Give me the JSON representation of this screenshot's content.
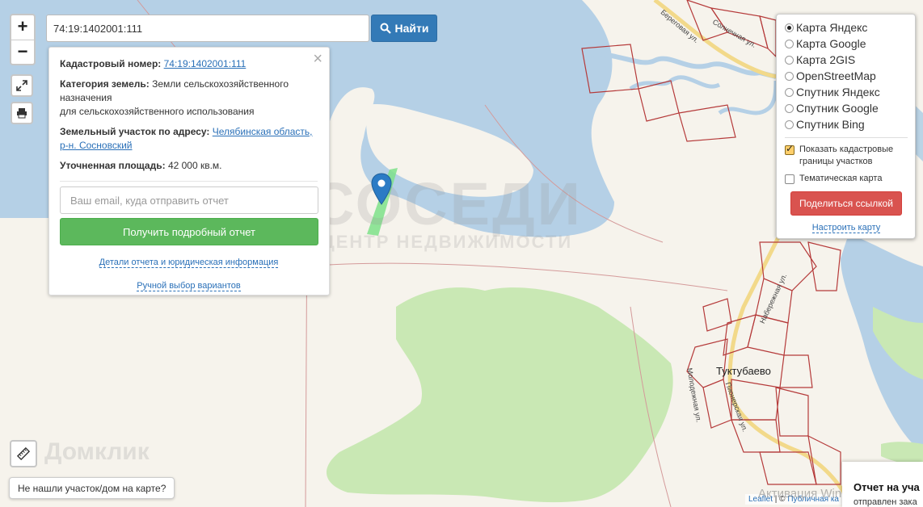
{
  "search": {
    "value": "74:19:1402001:111",
    "button_label": "Найти"
  },
  "zoom": {
    "in_label": "+",
    "out_label": "−"
  },
  "popup": {
    "close_label": "×",
    "cadastral_label": "Кадастровый номер:",
    "cadastral_value": "74:19:1402001:111",
    "category_label": "Категория земель:",
    "category_value_1": "Земли сельскохозяйственного",
    "category_value_2": "назначения",
    "category_value_3": "для сельскохозяйственного использования",
    "address_label": "Земельный участок по адресу:",
    "address_link_1": "Челябинская область,",
    "address_link_2": "р-н. Сосновский",
    "area_label": "Уточненная площадь:",
    "area_value": "42 000 кв.м.",
    "email_placeholder": "Ваш email, куда отправить отчет",
    "report_button": "Получить подробный отчет",
    "details_link": "Детали отчета и юридическая информация",
    "manual_link": "Ручной выбор вариантов"
  },
  "layers": {
    "options": [
      {
        "label": "Карта Яндекс",
        "selected": true
      },
      {
        "label": "Карта Google",
        "selected": false
      },
      {
        "label": "Карта 2GIS",
        "selected": false
      },
      {
        "label": "OpenStreetMap",
        "selected": false
      },
      {
        "label": "Спутник Яндекс",
        "selected": false
      },
      {
        "label": "Спутник Google",
        "selected": false
      },
      {
        "label": "Спутник Bing",
        "selected": false
      }
    ],
    "show_borders_1": "Показать кадастровые",
    "show_borders_2": "границы участков",
    "thematic": "Тематическая карта",
    "share_button": "Поделиться ссылкой",
    "setup_link": "Настроить карту"
  },
  "not_found": "Не нашли участок/дом на карте?",
  "attribution": {
    "leaflet": "Leaflet",
    "sep": " | © ",
    "public": "Публичная ка"
  },
  "report_panel": {
    "title": "Отчет на уча",
    "subtitle": "отправлен зака"
  },
  "activation": "Активация Windows",
  "watermark": {
    "main": "СОСЕДИ",
    "sub": "ЦЕНТР НЕДВИЖИМОСТИ"
  },
  "domclick": "Домклик",
  "map": {
    "town": "Туктубаево",
    "streets": [
      "Береговая ул.",
      "Солнечная ул.",
      "Набережная ул.",
      "Молодежная ул.",
      "Пионерская ул."
    ]
  },
  "colors": {
    "water": "#b5d0e6",
    "forest": "#c9e8b4",
    "parcel": "#7ee08a",
    "border": "#b53a3a",
    "road": "#f2d98a",
    "marker": "#2b7bc5"
  }
}
